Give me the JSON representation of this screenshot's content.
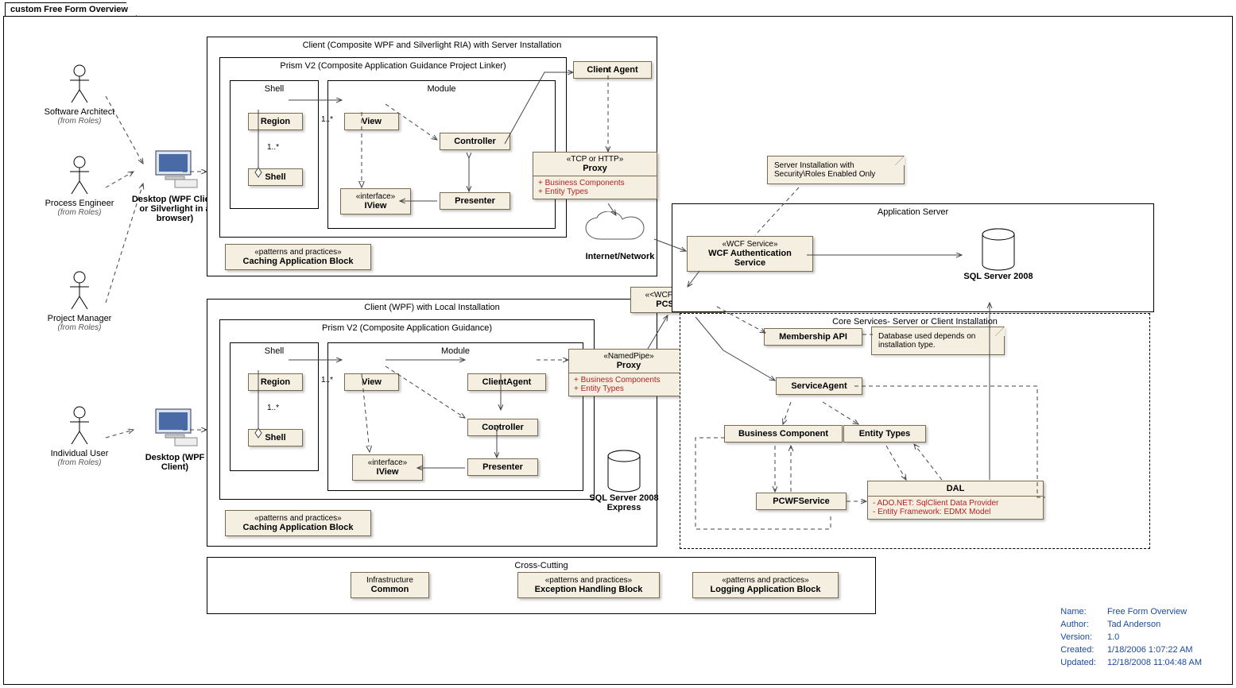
{
  "tab": "custom Free Form Overview",
  "actors": {
    "software_architect": {
      "name": "Software Architect",
      "from": "(from Roles)"
    },
    "process_engineer": {
      "name": "Process Engineer",
      "from": "(from Roles)"
    },
    "project_manager": {
      "name": "Project Manager",
      "from": "(from Roles)"
    },
    "individual_user": {
      "name": "Individual User",
      "from": "(from Roles)"
    }
  },
  "nodes": {
    "desktop1": "Desktop (WPF Client or Silverlight in a browser)",
    "desktop2": "Desktop (WPF Client)"
  },
  "frames": {
    "client1": "Client (Composite WPF and Silverlight RIA) with Server Installation",
    "client2": "Client (WPF) with Local Installation",
    "prism1": "Prism V2 (Composite Application Guidance Project Linker)",
    "prism2": "Prism V2 (Composite Application Guidance)",
    "shell": "Shell",
    "module": "Module",
    "appserver": "Application Server",
    "coresvcs": "Core Services- Server or Client Installation",
    "crosscut": "Cross-Cutting"
  },
  "boxes": {
    "region": "Region",
    "shell": "Shell",
    "view": "View",
    "iview_st": "«interface»",
    "iview": "IView",
    "presenter": "Presenter",
    "controller": "Controller",
    "clientagent": "Client Agent",
    "clientagent2": "ClientAgent",
    "proxy1_st": "«TCP or HTTP»",
    "proxy": "Proxy",
    "bc_line": "+   Business Components",
    "et_line": "+   Entity Types",
    "proxy2_st": "«NamedPipe»",
    "wcf_auth_st": "«WCF Service»",
    "wcf_auth": "WCF Authentication Service",
    "pcservice_st": "«<WCF Service>»",
    "pcservice": "PCService",
    "membership": "Membership API",
    "serviceagent": "ServiceAgent",
    "businesscomp": "Business Component",
    "entitytypes": "Entity Types",
    "pcwf": "PCWFService",
    "dal": "DAL",
    "dal_l1": "-   ADO.NET:  SqlClient Data Provider",
    "dal_l2": "-   Entity Framework:  EDMX Model",
    "cache_st": "«patterns and practices»",
    "cache": "Caching Application Block",
    "infra_t": "Infrastructure",
    "common": "Common",
    "ex_st": "«patterns and practices»",
    "ex": "Exception Handling Block",
    "log_st": "«patterns and practices»",
    "log": "Logging Application Block"
  },
  "labels": {
    "mult": "1..*",
    "cloud": "Internet/Network",
    "sql": "SQL Server 2008",
    "sqlexpress": "SQL Server 2008 Express"
  },
  "notes": {
    "server_inst": "Server Installation with Security\\Roles Enabled Only",
    "db_depends": "Database used depends on installation type."
  },
  "meta": {
    "name_l": "Name:",
    "name_v": "Free Form Overview",
    "author_l": "Author:",
    "author_v": "Tad Anderson",
    "version_l": "Version:",
    "version_v": "1.0",
    "created_l": "Created:",
    "created_v": "1/18/2006 1:07:22 AM",
    "updated_l": "Updated:",
    "updated_v": "12/18/2008 11:04:48 AM"
  }
}
